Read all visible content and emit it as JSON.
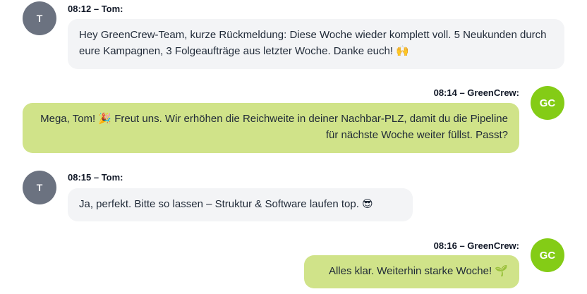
{
  "messages": [
    {
      "avatar_initials": "T",
      "meta": "08:12 – Tom:",
      "text": "Hey GreenCrew-Team, kurze Rückmeldung: Diese Woche wieder komplett voll. 5 Neukunden durch eure Kampagnen, 3 Folgeaufträge aus letzter Woche. Danke euch! 🙌",
      "emoji_icon": "raising-hands-icon"
    },
    {
      "avatar_initials": "GC",
      "meta": "08:14 – GreenCrew:",
      "text": "Mega, Tom! 🎉 Freut uns. Wir erhöhen die Reichweite in deiner Nachbar-PLZ, damit du die Pipeline für nächste Woche weiter füllst. Passt?",
      "emoji_icon": "party-popper-icon"
    },
    {
      "avatar_initials": "T",
      "meta": "08:15 – Tom:",
      "text": "Ja, perfekt. Bitte so lassen – Struktur & Software laufen top. 😎",
      "emoji_icon": "sunglasses-face-icon"
    },
    {
      "avatar_initials": "GC",
      "meta": "08:16 – GreenCrew:",
      "text": "Alles klar. Weiterhin starke Woche! 🌱",
      "emoji_icon": "seedling-icon"
    }
  ],
  "colors": {
    "tom_avatar": "#6b7280",
    "greencrew_avatar": "#84cc16",
    "incoming_bubble": "#f3f4f6",
    "outgoing_bubble": "#d0e389"
  }
}
